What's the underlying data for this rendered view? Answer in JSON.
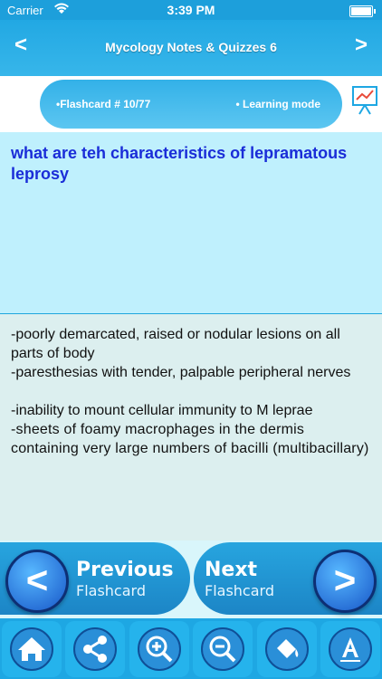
{
  "status_bar": {
    "carrier": "Carrier",
    "time": "3:39 PM"
  },
  "navbar": {
    "title": "Mycology Notes & Quizzes 6",
    "back_glyph": "<",
    "forward_glyph": ">"
  },
  "info": {
    "flashcard": "•Flashcard #  10/77",
    "mode": "• Learning mode"
  },
  "question": "what are teh characteristics of lepramatous leprosy",
  "answer_lines": [
    "-poorly demarcated, raised or nodular lesions on all parts of body",
    "-paresthesias with tender, palpable peripheral nerves",
    "-inability to mount cellular immunity to M leprae",
    "-sheets of foamy macrophages in the dermis containing very large numbers of bacilli (multibacillary)"
  ],
  "nav": {
    "prev_big": "Previous",
    "prev_small": "Flashcard",
    "next_big": "Next",
    "next_small": "Flashcard",
    "prev_glyph": "<",
    "next_glyph": ">"
  },
  "toolbar": [
    "home-icon",
    "share-icon",
    "zoom-in-icon",
    "zoom-out-icon",
    "paint-bucket-icon",
    "font-icon"
  ],
  "colors": {
    "accent": "#1ea7e3",
    "question_bg": "#bff0fd",
    "question_text": "#1a2dd8",
    "answer_bg": "#dcefef"
  }
}
